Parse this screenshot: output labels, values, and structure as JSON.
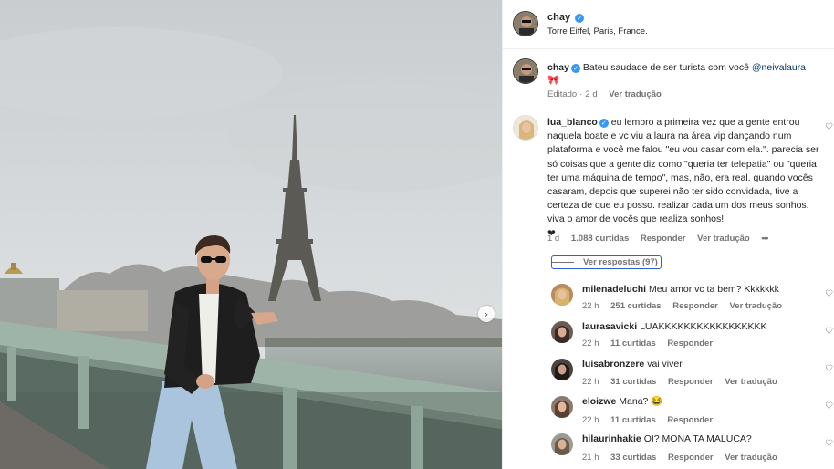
{
  "post": {
    "author": "chay",
    "location": "Torre Eiffel, Paris, France.",
    "caption_author": "chay",
    "caption_text": "Bateu saudade de ser turista com você",
    "caption_mention": "@neivalaura",
    "caption_emoji": "🎀",
    "edited_label": "Editado",
    "edited_age": "2 d",
    "see_translation": "Ver tradução"
  },
  "main_comment": {
    "author": "lua_blanco",
    "text": "eu lembro a primeira vez que a gente entrou naquela boate e vc viu a laura na área vip dançando num plataforma e você me falou \"eu vou casar com ela.\". parecia ser só coisas que a gente diz como \"queria ter telepatia\" ou \"queria ter uma máquina de tempo\", mas, não, era real. quando vocês casaram, depois que superei não ter sido convidada, tive a certeza de que eu posso. realizar cada um dos meus sonhos. viva o amor de vocês que realiza sonhos!",
    "emoji": "❤",
    "age": "1 d",
    "likes": "1.088 curtidas",
    "reply": "Responder",
    "translate": "Ver tradução",
    "more": "•••",
    "view_replies": "Ver respostas (97)"
  },
  "replies": [
    {
      "author": "milenadeluchi",
      "text": "Meu amor vc ta bem? Kkkkkkk",
      "age": "22 h",
      "likes": "251 curtidas",
      "reply": "Responder",
      "translate": "Ver tradução"
    },
    {
      "author": "laurasavicki",
      "text": "LUAKKKKKKKKKKKKKKKKK",
      "age": "22 h",
      "likes": "11 curtidas",
      "reply": "Responder",
      "translate": ""
    },
    {
      "author": "luisabronzere",
      "text": "vai viver",
      "age": "22 h",
      "likes": "31 curtidas",
      "reply": "Responder",
      "translate": "Ver tradução"
    },
    {
      "author": "eloizwe",
      "text": "Mana? 😂",
      "age": "22 h",
      "likes": "11 curtidas",
      "reply": "Responder",
      "translate": ""
    },
    {
      "author": "hilaurinhakie",
      "text": "OI? MONA TA MALUCA?",
      "age": "21 h",
      "likes": "33 curtidas",
      "reply": "Responder",
      "translate": "Ver tradução"
    }
  ],
  "colors": {
    "verified": "#3897f0",
    "link": "#00376b",
    "muted": "#737373"
  },
  "icons": {
    "heart": "heart-icon",
    "verified": "verified-badge-icon",
    "next": "chevron-right-icon"
  }
}
